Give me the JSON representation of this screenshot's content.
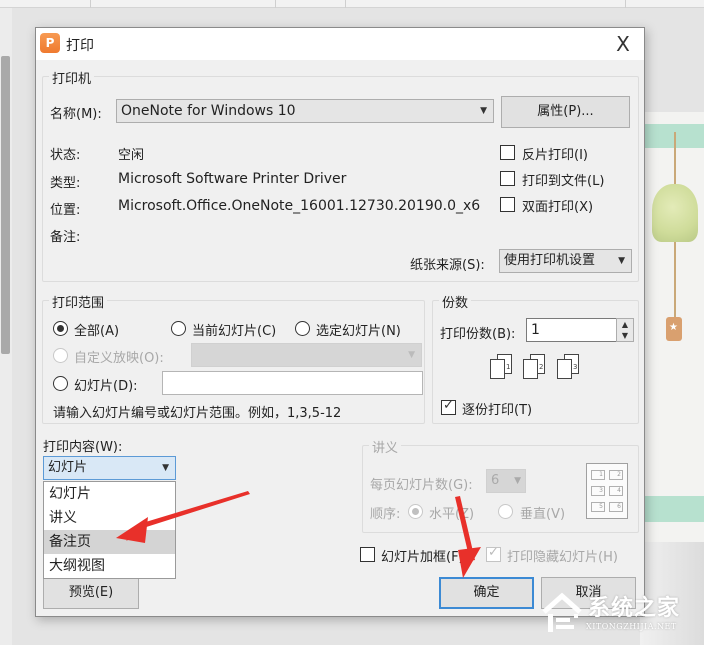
{
  "dialog": {
    "title": "打印",
    "app_icon_glyph": "P",
    "close_glyph": "X"
  },
  "printer": {
    "group_title": "打印机",
    "name_label": "名称(M):",
    "name_value": "OneNote for Windows 10",
    "properties_button": "属性(P)...",
    "status_label": "状态:",
    "status_value": "空闲",
    "type_label": "类型:",
    "type_value": "Microsoft Software Printer Driver",
    "location_label": "位置:",
    "location_value": "Microsoft.Office.OneNote_16001.12730.20190.0_x6",
    "comment_label": "备注:",
    "comment_value": "",
    "checkboxes": [
      {
        "label": "反片打印(I)",
        "checked": false
      },
      {
        "label": "打印到文件(L)",
        "checked": false
      },
      {
        "label": "双面打印(X)",
        "checked": false
      }
    ],
    "paper_source_label": "纸张来源(S):",
    "paper_source_value": "使用打印机设置"
  },
  "range": {
    "group_title": "打印范围",
    "all_label": "全部(A)",
    "current_label": "当前幻灯片(C)",
    "selection_label": "选定幻灯片(N)",
    "custom_label": "自定义放映(O):",
    "custom_value": "",
    "slides_label": "幻灯片(D):",
    "slides_value": "",
    "hint": "请输入幻灯片编号或幻灯片范围。例如，1,3,5-12",
    "selected": "all"
  },
  "copies": {
    "group_title": "份数",
    "count_label": "打印份数(B):",
    "count_value": "1",
    "collate_label": "逐份打印(T)",
    "collate_checked": true,
    "icon_numbers": [
      "1",
      "2",
      "3"
    ]
  },
  "content": {
    "label": "打印内容(W):",
    "selected": "幻灯片",
    "options": [
      "幻灯片",
      "讲义",
      "备注页",
      "大纲视图"
    ],
    "hovered_option": "备注页"
  },
  "handouts": {
    "group_title": "讲义",
    "per_page_label": "每页幻灯片数(G):",
    "per_page_value": "6",
    "order_label": "顺序:",
    "horizontal_label": "水平(Z)",
    "vertical_label": "垂直(V)",
    "order_selected": "horizontal",
    "layout_numbers": [
      "1",
      "2",
      "3",
      "4",
      "5",
      "6"
    ]
  },
  "options": {
    "frame_label": "幻灯片加框(F)",
    "frame_checked": false,
    "hidden_label": "打印隐藏幻灯片(H)",
    "hidden_checked": true
  },
  "buttons": {
    "preview": "预览(E)",
    "ok": "确定",
    "cancel": "取消"
  },
  "annotations": {
    "arrow_color": "#e8302a"
  },
  "watermark": {
    "title": "系统之家",
    "subtitle": "XITONGZHIJIA.NET"
  }
}
